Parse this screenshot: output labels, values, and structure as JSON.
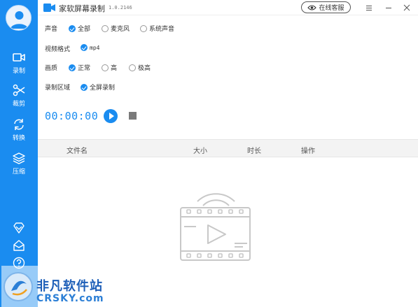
{
  "app": {
    "title": "家软屏幕录制",
    "version": "1.0.2146",
    "support_label": "在线客服"
  },
  "sidebar": {
    "items": [
      {
        "label": "录制",
        "icon": "video-camera-icon",
        "active": true
      },
      {
        "label": "裁剪",
        "icon": "scissors-icon",
        "active": false
      },
      {
        "label": "转换",
        "icon": "refresh-icon",
        "active": false
      },
      {
        "label": "压缩",
        "icon": "layers-icon",
        "active": false
      }
    ],
    "bottom_icons": [
      "vip-diamond-icon",
      "mail-icon",
      "help-icon",
      "settings-icon"
    ]
  },
  "settings": {
    "sound": {
      "label": "声音",
      "options": [
        "全部",
        "麦克风",
        "系统声音"
      ],
      "selected": "全部"
    },
    "format": {
      "label": "视频格式",
      "options": [
        "mp4"
      ],
      "selected": "mp4"
    },
    "quality": {
      "label": "画质",
      "options": [
        "正常",
        "高",
        "极高"
      ],
      "selected": "正常"
    },
    "area": {
      "label": "录制区域",
      "options": [
        "全屏录制"
      ],
      "selected": "全屏录制"
    }
  },
  "recorder": {
    "timer": "00:00:00"
  },
  "table": {
    "columns": [
      "文件名",
      "大小",
      "时长",
      "操作"
    ]
  },
  "watermark": {
    "line1": "非凡软件站",
    "line2": "CRSKY.com"
  },
  "colors": {
    "accent": "#1a8cf0",
    "sidebar": "#1a8cf0",
    "table_header_bg": "#f3f3f3"
  }
}
